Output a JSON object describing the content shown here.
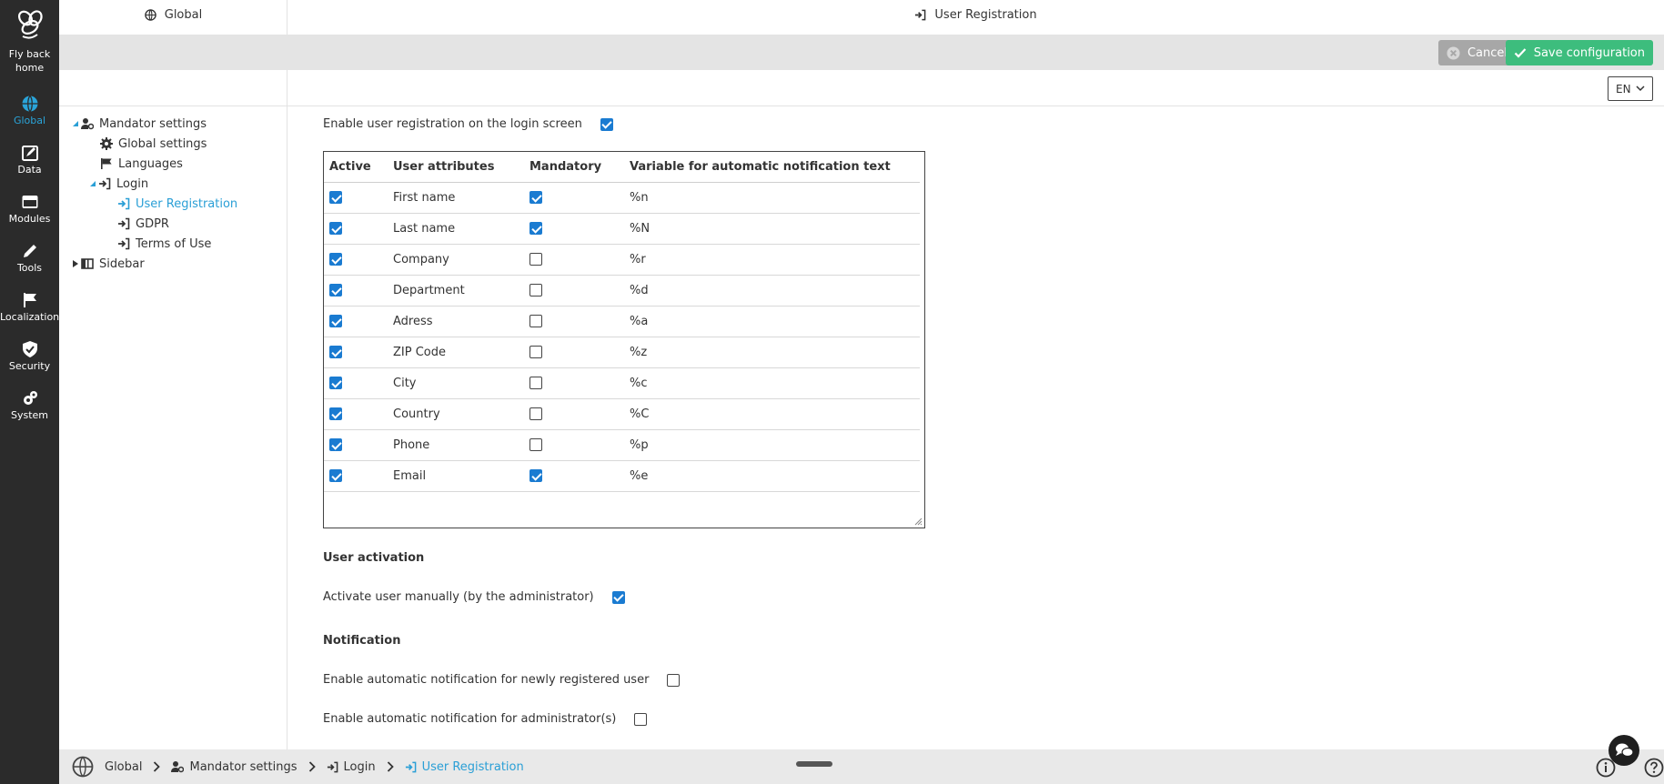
{
  "leftnav": {
    "home_label_1": "Fly back",
    "home_label_2": "home",
    "items": [
      {
        "label": "Global"
      },
      {
        "label": "Data"
      },
      {
        "label": "Modules"
      },
      {
        "label": "Tools"
      },
      {
        "label": "Localization"
      },
      {
        "label": "Security"
      },
      {
        "label": "System"
      }
    ],
    "active_color": "#2aa4d9"
  },
  "tree_panel": {
    "title": "Global",
    "items": [
      {
        "label": "Mandator settings"
      },
      {
        "label": "Global settings"
      },
      {
        "label": "Languages"
      },
      {
        "label": "Login"
      },
      {
        "label": "User Registration"
      },
      {
        "label": "GDPR"
      },
      {
        "label": "Terms of Use"
      },
      {
        "label": "Sidebar"
      }
    ]
  },
  "main_panel": {
    "title": "User Registration",
    "cancel_label": "Cancel",
    "save_label": "Save configuration",
    "language": "EN"
  },
  "form": {
    "enable_registration_label": "Enable user registration on the login screen",
    "enable_registration_checked": true,
    "table": {
      "headers": [
        "Active",
        "User attributes",
        "Mandatory",
        "Variable for automatic notification text"
      ],
      "rows": [
        {
          "active": true,
          "attribute": "First name",
          "mandatory": true,
          "variable": "%n"
        },
        {
          "active": true,
          "attribute": "Last name",
          "mandatory": true,
          "variable": "%N"
        },
        {
          "active": true,
          "attribute": "Company",
          "mandatory": false,
          "variable": "%r"
        },
        {
          "active": true,
          "attribute": "Department",
          "mandatory": false,
          "variable": "%d"
        },
        {
          "active": true,
          "attribute": "Adress",
          "mandatory": false,
          "variable": "%a"
        },
        {
          "active": true,
          "attribute": "ZIP Code",
          "mandatory": false,
          "variable": "%z"
        },
        {
          "active": true,
          "attribute": "City",
          "mandatory": false,
          "variable": "%c"
        },
        {
          "active": true,
          "attribute": "Country",
          "mandatory": false,
          "variable": "%C"
        },
        {
          "active": true,
          "attribute": "Phone",
          "mandatory": false,
          "variable": "%p"
        },
        {
          "active": true,
          "attribute": "Email",
          "mandatory": true,
          "variable": "%e"
        }
      ]
    },
    "user_activation_heading": "User activation",
    "activate_manually_label": "Activate user manually (by the administrator)",
    "activate_manually_checked": true,
    "notification_heading": "Notification",
    "notify_user_label": "Enable automatic notification for newly registered user",
    "notify_user_checked": false,
    "notify_admin_label": "Enable automatic notification for administrator(s)",
    "notify_admin_checked": false
  },
  "breadcrumb": {
    "items": [
      {
        "label": "Global"
      },
      {
        "label": "Mandator settings"
      },
      {
        "label": "Login"
      },
      {
        "label": "User Registration"
      }
    ]
  },
  "colors": {
    "accent": "#2a9fd6",
    "save": "#3dbd7d",
    "cancel": "#a7a7a7",
    "checkbox": "#1a7bd1"
  }
}
